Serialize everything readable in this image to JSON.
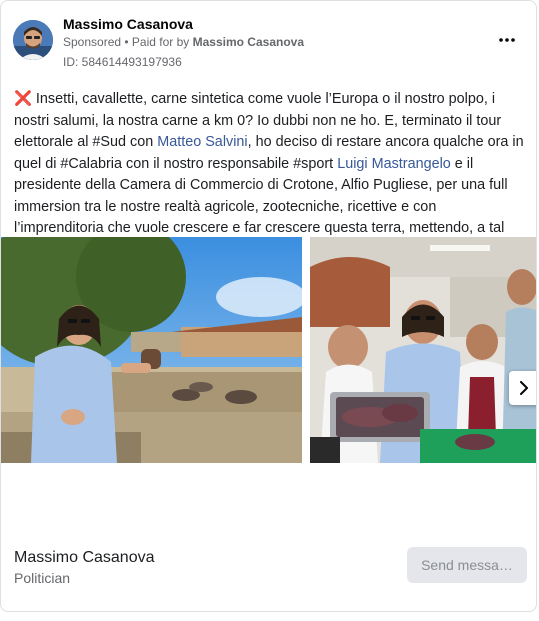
{
  "ad": {
    "page_name": "Massimo Casanova",
    "sponsored_label": "Sponsored",
    "separator": " • ",
    "paid_for_prefix": "Paid for by ",
    "paid_for_name": "Massimo Casanova",
    "ad_id": "ID: 584614493197936",
    "more_icon": "ellipsis-icon"
  },
  "body": {
    "emoji_icon": "cross-mark-icon",
    "emoji": "❌",
    "part1": "Insetti, cavallette, carne sintetica come vuole l’Europa o il nostro polpo, i nostri salumi, la nostra carne a km 0? Io dubbi non ne ho. E, terminato il tour elettorale al #Sud con ",
    "link1": "Matteo Salvini",
    "part2": ", ho deciso di restare ancora qualche ora in quel di #Calabria con il nostro responsabile #sport ",
    "link2": "Luigi Mastrangelo",
    "part3": " e il presidente della Camera di Commercio di Crotone, Alfio Pugliese, per una full immersion tra le nostre realtà agricole, zootecniche, ricettive e con l’imprenditoria che vuole crescere e far crescere questa terra, mettendo, a tal proposito, a disposizione la…"
  },
  "carousel": {
    "next_icon": "chevron-right-icon"
  },
  "footer": {
    "name": "Massimo Casanova",
    "category": "Politician",
    "cta_label": "Send messa…"
  },
  "colors": {
    "link": "#385898",
    "secondary_text": "#65676b",
    "button_bg": "#e4e6eb"
  }
}
